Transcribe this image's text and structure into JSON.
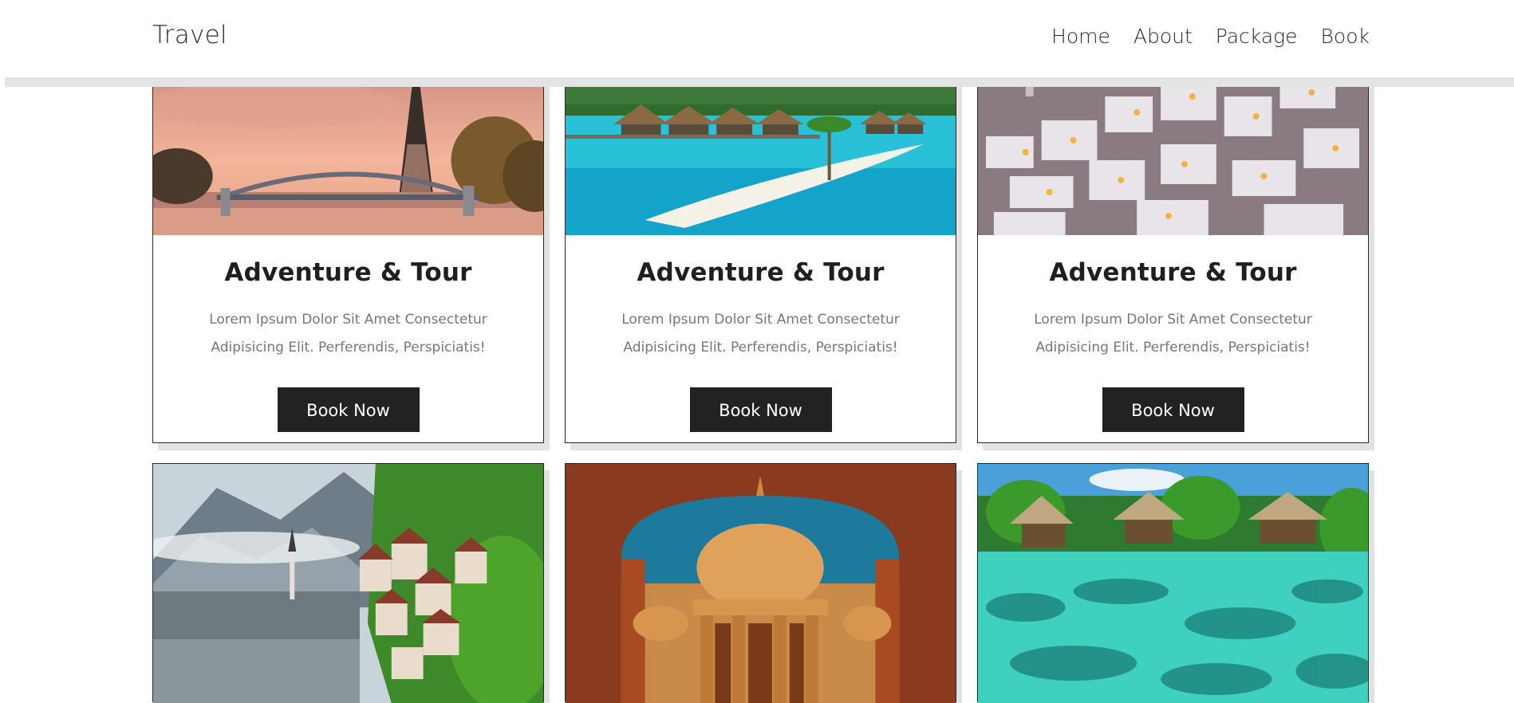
{
  "header": {
    "brand": "Travel",
    "nav": [
      "Home",
      "About",
      "Package",
      "Book"
    ]
  },
  "cards": [
    {
      "image": "eiffel-tower-paris-image",
      "title": "Adventure & Tour",
      "text": "Lorem Ipsum Dolor Sit Amet Consectetur Adipisicing Elit. Perferendis, Perspiciatis!",
      "button": "Book Now"
    },
    {
      "image": "tropical-overwater-bungalows-image",
      "title": "Adventure & Tour",
      "text": "Lorem Ipsum Dolor Sit Amet Consectetur Adipisicing Elit. Perferendis, Perspiciatis!",
      "button": "Book Now"
    },
    {
      "image": "santorini-village-image",
      "title": "Adventure & Tour",
      "text": "Lorem Ipsum Dolor Sit Amet Consectetur Adipisicing Elit. Perferendis, Perspiciatis!",
      "button": "Book Now"
    },
    {
      "image": "hallstatt-lake-village-image"
    },
    {
      "image": "indian-palace-chhatri-image"
    },
    {
      "image": "coral-lagoon-huts-image"
    }
  ],
  "colors": {
    "button_bg": "#222222",
    "button_text": "#ffffff",
    "title": "#1f1f1f",
    "body_text": "#777777",
    "shadow": "#e2e2e2"
  }
}
